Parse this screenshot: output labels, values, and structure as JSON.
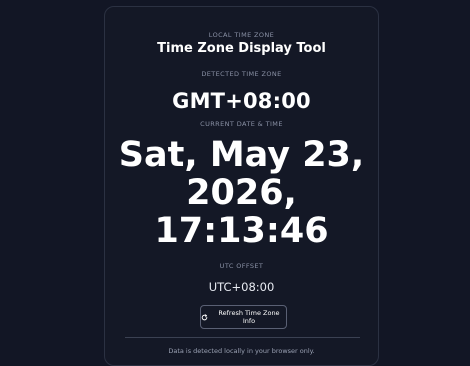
{
  "header": {
    "eyebrow": "LOCAL TIME ZONE",
    "title": "Time Zone Display Tool"
  },
  "detected": {
    "label": "DETECTED TIME ZONE",
    "value": "GMT+08:00"
  },
  "current": {
    "label": "CURRENT DATE & TIME",
    "line1": "Sat, May 23,",
    "line2": "2026,",
    "line3": "17:13:46"
  },
  "offset": {
    "label": "UTC OFFSET",
    "value": "UTC+08:00"
  },
  "actions": {
    "refresh_label": "Refresh Time Zone Info",
    "refresh_icon": "refresh-icon"
  },
  "footer": {
    "note": "Data is detected locally in your browser only."
  },
  "colors": {
    "background": "#121625",
    "card": "#141826",
    "border": "#2b3142",
    "text": "#ffffff",
    "muted": "#8a91a5"
  }
}
